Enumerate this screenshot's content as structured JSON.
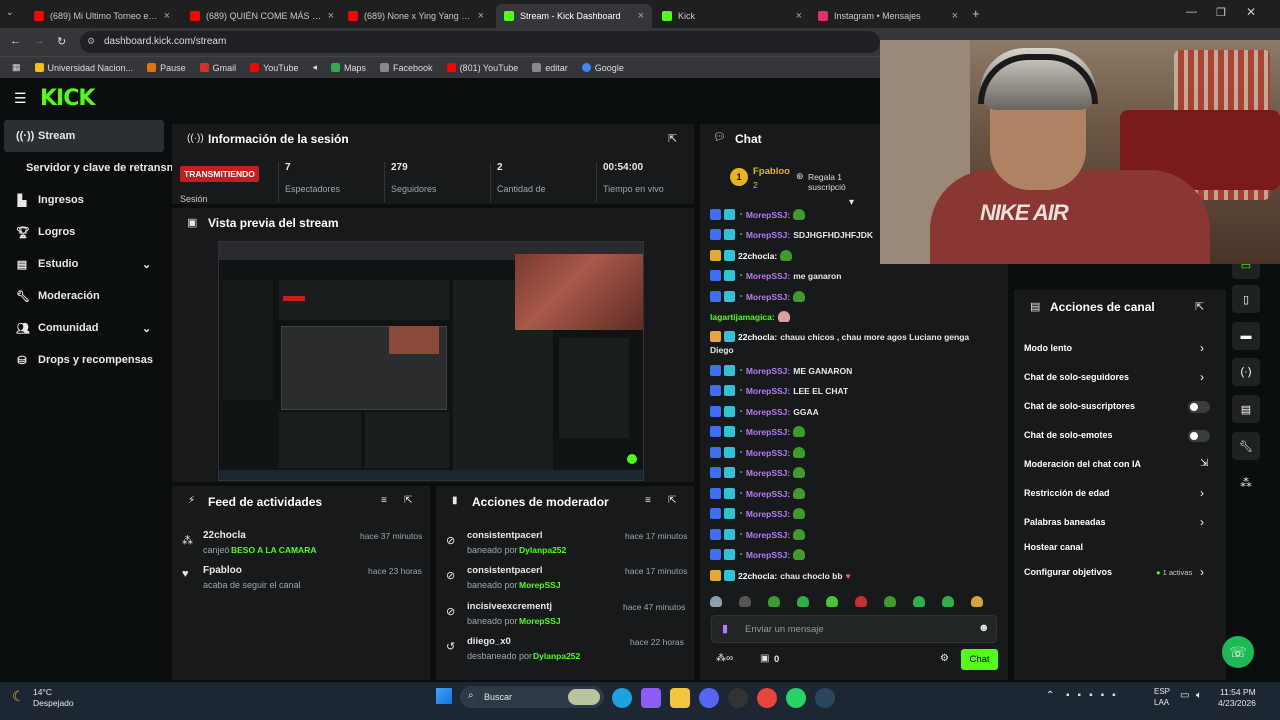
{
  "browser": {
    "tabs": [
      {
        "label": "(689) Mi Ultimo Torneo en Mar",
        "color": "#ff0000"
      },
      {
        "label": "(689) QUIÉN COME MÁS NUGG",
        "color": "#ff0000"
      },
      {
        "label": "(689) None x Ying Yang x Esta",
        "color": "#ff0000"
      },
      {
        "label": "Stream - Kick Dashboard",
        "color": "#53fc18"
      },
      {
        "label": "Kick",
        "color": "#53fc18"
      },
      {
        "label": "Instagram • Mensajes",
        "color": "#e1306c"
      }
    ],
    "url": "dashboard.kick.com/stream",
    "bookmarks": [
      "Universidad Nacion...",
      "Pause",
      "Gmail",
      "YouTube",
      "Maps",
      "Facebook",
      "(801) YouTube",
      "editar",
      "Google"
    ]
  },
  "header": {
    "logo": "KICK"
  },
  "sidebar": {
    "items": [
      {
        "label": "Stream",
        "icon": "broadcast-icon"
      },
      {
        "label": "Servidor y clave de retransn",
        "icon": ""
      },
      {
        "label": "Ingresos",
        "icon": "chart-icon"
      },
      {
        "label": "Logros",
        "icon": "trophy-icon"
      },
      {
        "label": "Estudio",
        "icon": "studio-icon"
      },
      {
        "label": "Moderación",
        "icon": "wrench-icon"
      },
      {
        "label": "Comunidad",
        "icon": "people-icon"
      },
      {
        "label": "Drops y recompensas",
        "icon": "gift-icon"
      }
    ]
  },
  "session": {
    "title": "Información de la sesión",
    "status": "TRANSMITIENDO",
    "status_label": "Sesión",
    "stats": [
      {
        "value": "7",
        "label": "Espectadores"
      },
      {
        "value": "279",
        "label": "Seguidores"
      },
      {
        "value": "2",
        "label": "Cantidad de"
      },
      {
        "value": "00:54:00",
        "label": "Tiempo en vivo"
      }
    ]
  },
  "preview": {
    "title": "Vista previa del stream"
  },
  "feed": {
    "title": "Feed de actividades",
    "items": [
      {
        "user": "22chocla",
        "action": "canjeó",
        "highlight": "BESO A LA CAMARA",
        "time": "hace 37 minutos"
      },
      {
        "user": "Fpabloo",
        "action": "acaba de seguir el canal",
        "highlight": "",
        "time": "hace 23 horas"
      }
    ]
  },
  "modactions": {
    "title": "Acciones de moderador",
    "items": [
      {
        "user": "consistentpacerl",
        "action": "baneado por",
        "by": "Dylanpa252",
        "time": "hace 17 minutos"
      },
      {
        "user": "consistentpacerl",
        "action": "baneado por",
        "by": "MorepSSJ",
        "time": "hace 17 minutos"
      },
      {
        "user": "incisiveexcrementj",
        "action": "baneado por",
        "by": "MorepSSJ",
        "time": "hace 47 minutos"
      },
      {
        "user": "diiego_x0",
        "action": "desbaneado por",
        "by": "Dylanpa252",
        "time": "hace 22 horas"
      }
    ]
  },
  "chat": {
    "title": "Chat",
    "pinned_user": "Fpabloo",
    "pinned_rank": "1",
    "pinned_count": "2",
    "pinned_text": "Regala 1 suscripció",
    "messages": [
      {
        "user": "MorepSSJ:",
        "text": "",
        "emote": true
      },
      {
        "user": "MorepSSJ:",
        "text": "SDJHGFHDJHFJDK",
        "emote": false
      },
      {
        "user": "22chocla:",
        "text": "",
        "emote": true
      },
      {
        "user": "MorepSSJ:",
        "text": "me ganaron",
        "emote": false
      },
      {
        "user": "MorepSSJ:",
        "text": "",
        "emote": true
      },
      {
        "user": "lagartijamagica:",
        "text": "",
        "emote": true
      },
      {
        "user": "22chocla:",
        "text": "chauu chicos , chau more agos Luciano genga",
        "text2": "Diego",
        "emote": false
      },
      {
        "user": "MorepSSJ:",
        "text": "ME GANARON",
        "emote": false
      },
      {
        "user": "MorepSSJ:",
        "text": "LEE EL CHAT",
        "emote": false
      },
      {
        "user": "MorepSSJ:",
        "text": "GGAA",
        "emote": false
      },
      {
        "user": "MorepSSJ:",
        "text": "",
        "emote": true
      },
      {
        "user": "MorepSSJ:",
        "text": "",
        "emote": true
      },
      {
        "user": "MorepSSJ:",
        "text": "",
        "emote": true
      },
      {
        "user": "MorepSSJ:",
        "text": "",
        "emote": true
      },
      {
        "user": "MorepSSJ:",
        "text": "",
        "emote": true
      },
      {
        "user": "MorepSSJ:",
        "text": "",
        "emote": true
      },
      {
        "user": "MorepSSJ:",
        "text": "",
        "emote": true
      },
      {
        "user": "22chocla:",
        "text": "chau choclo bb",
        "emote": false
      }
    ],
    "input_placeholder": "Enviar un mensaje",
    "points": "0",
    "send_label": "Chat"
  },
  "channel_actions": {
    "title": "Acciones de canal",
    "items": [
      {
        "label": "Modo lento",
        "control": "chevron"
      },
      {
        "label": "Chat de solo-seguidores",
        "control": "chevron"
      },
      {
        "label": "Chat de solo-suscriptores",
        "control": "toggle"
      },
      {
        "label": "Chat de solo-emotes",
        "control": "toggle"
      },
      {
        "label": "Moderación del chat con IA",
        "control": "external"
      },
      {
        "label": "Restricción de edad",
        "control": "chevron"
      },
      {
        "label": "Palabras baneadas",
        "control": "chevron"
      },
      {
        "label": "Hostear canal",
        "control": "none"
      },
      {
        "label": "Configurar objetivos",
        "control": "chevron",
        "extra": "1 activas"
      }
    ]
  },
  "webcam": {
    "shirt_text": "NIKE AIR"
  },
  "taskbar": {
    "weather_temp": "14°C",
    "weather_desc": "Despejado",
    "search": "Buscar",
    "lang": "ESP",
    "lang2": "LAA",
    "time": "11:54 PM",
    "date": "4/23/2026"
  },
  "colors": {
    "accent": "#53fc18",
    "live": "#e51a1a",
    "panel": "#17191a"
  }
}
